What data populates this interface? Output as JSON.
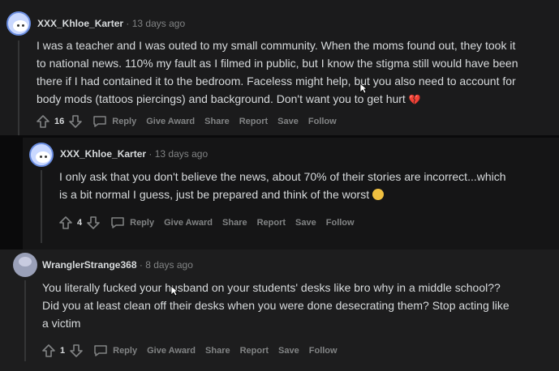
{
  "comments": [
    {
      "username": "XXX_Khloe_Karter",
      "separator": "·",
      "time": "13 days ago",
      "lines": [
        "I was a teacher and I was outed to my small community. When the moms found out, they took it",
        "to national news. 110% my fault as I filmed in public, but I know the stigma still would have been",
        "there if I had contained it to the bedroom. Faceless might help, but you also need to account for",
        "body mods (tattoos piercings) and background. Don't want you to get hurt"
      ],
      "votes": "16",
      "actions": {
        "reply": "Reply",
        "award": "Give Award",
        "share": "Share",
        "report": "Report",
        "save": "Save",
        "follow": "Follow"
      }
    },
    {
      "username": "XXX_Khloe_Karter",
      "separator": "·",
      "time": "13 days ago",
      "lines": [
        "I only ask that you don't believe the news, about 70% of their stories are incorrect...which",
        "is a bit normal I guess, just be prepared and think of the worst"
      ],
      "votes": "4",
      "actions": {
        "reply": "Reply",
        "award": "Give Award",
        "share": "Share",
        "report": "Report",
        "save": "Save",
        "follow": "Follow"
      }
    },
    {
      "username": "WranglerStrange368",
      "separator": "·",
      "time": "8 days ago",
      "lines": [
        "You literally fucked your husband on your students' desks like bro why in a middle school??",
        "Did you at least clean off their desks when you were done desecrating them? Stop acting like",
        "a victim"
      ],
      "votes": "1",
      "actions": {
        "reply": "Reply",
        "award": "Give Award",
        "share": "Share",
        "report": "Report",
        "save": "Save",
        "follow": "Follow"
      }
    }
  ],
  "colors": {
    "background": "#1a1a1b",
    "text": "#d7dadc",
    "muted": "#818384",
    "heart": "#e0536d"
  },
  "icons": [
    "upvote-icon",
    "downvote-icon",
    "comment-bubble-icon",
    "broken-heart-icon",
    "grimace-emoji-icon",
    "mouse-cursor-icon"
  ]
}
